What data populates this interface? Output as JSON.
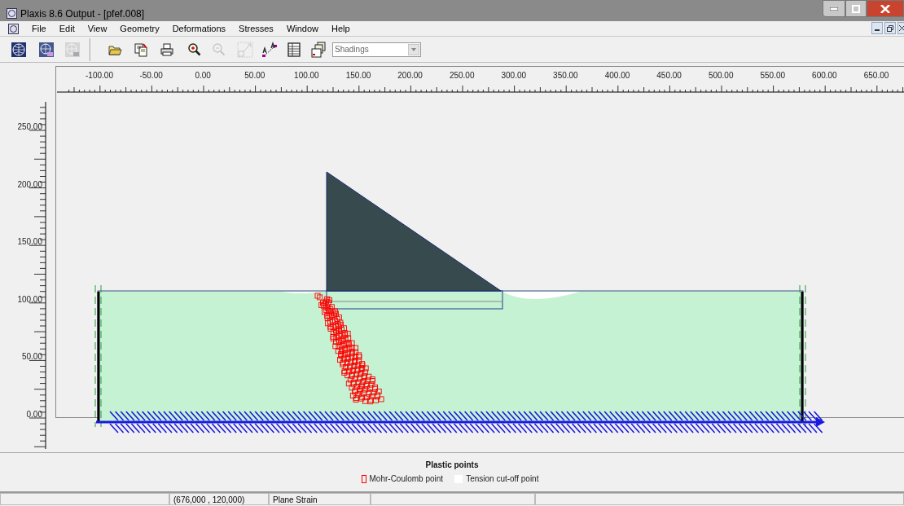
{
  "window": {
    "title": "Plaxis 8.6 Output - [pfef.008]"
  },
  "menu": [
    "File",
    "Edit",
    "View",
    "Geometry",
    "Deformations",
    "Stresses",
    "Window",
    "Help"
  ],
  "toolbar": {
    "buttons": [
      {
        "kind": "globe",
        "disabled": false
      },
      {
        "kind": "globe-1",
        "disabled": false
      },
      {
        "kind": "globe-2",
        "disabled": true
      },
      {
        "kind": "open",
        "disabled": false
      },
      {
        "kind": "copy",
        "disabled": false
      },
      {
        "kind": "print",
        "disabled": false
      },
      {
        "kind": "zoom-in",
        "disabled": false
      },
      {
        "kind": "zoom-out",
        "disabled": true
      },
      {
        "kind": "zoom-box",
        "disabled": true
      },
      {
        "kind": "cross-section",
        "disabled": false
      },
      {
        "kind": "table",
        "disabled": false
      },
      {
        "kind": "report",
        "disabled": false
      }
    ],
    "dropdown": {
      "value": "Shadings"
    }
  },
  "ruler_x": {
    "labels": [
      "-100.00",
      "-50.00",
      "0.00",
      "50.00",
      "100.00",
      "150.00",
      "200.00",
      "250.00",
      "300.00",
      "350.00",
      "400.00",
      "450.00",
      "500.00",
      "550.00",
      "600.00",
      "650.00"
    ]
  },
  "ruler_y": {
    "labels": [
      "250.00",
      "200.00",
      "150.00",
      "100.00",
      "50.00",
      "0.00"
    ]
  },
  "legend": {
    "title": "Plastic points",
    "items": [
      {
        "label": "Mohr-Coulomb point",
        "color": "#ff0000"
      },
      {
        "label": "Tension cut-off point",
        "color": "#ffffff"
      }
    ]
  },
  "status_bar": {
    "coordinates": "(676,000 , 120,000)",
    "mode": "Plane Strain"
  }
}
